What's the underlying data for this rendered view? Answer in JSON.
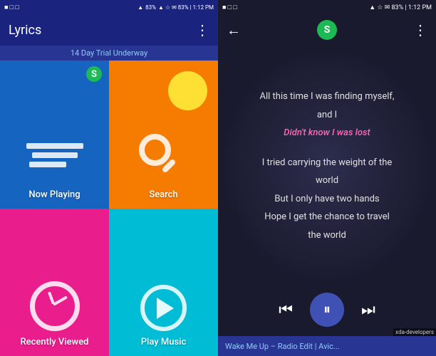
{
  "left": {
    "status_bar": {
      "left": "■ □ □",
      "right": "▲ ☆ ✉ 83% | 1:12 PM"
    },
    "title": "Lyrics",
    "menu_icon": "⋮",
    "trial_text": "14 Day Trial Underway",
    "spotify_label": "S",
    "cells": [
      {
        "id": "now-playing",
        "label": "Now Playing",
        "color": "#1565c0"
      },
      {
        "id": "search",
        "label": "Search",
        "color": "#f57c00"
      },
      {
        "id": "recently-viewed",
        "label": "Recently Viewed",
        "color": "#e91e8c"
      },
      {
        "id": "play-music",
        "label": "Play Music",
        "color": "#00bcd4"
      }
    ]
  },
  "right": {
    "status_bar": {
      "left": "■ □ □",
      "right": "▲ ☆ ✉ 83% | 1:12 PM"
    },
    "back_icon": "←",
    "spotify_label": "S",
    "menu_icon": "⋮",
    "lyrics": [
      {
        "text": "All this time I was finding myself,",
        "style": "normal"
      },
      {
        "text": "and I",
        "style": "normal"
      },
      {
        "text": "Didn't know I was lost",
        "style": "italic-pink"
      },
      {
        "text": "",
        "style": "spacer"
      },
      {
        "text": "I tried carrying the weight of the",
        "style": "normal"
      },
      {
        "text": "world",
        "style": "normal"
      },
      {
        "text": "But I only have two hands",
        "style": "normal"
      },
      {
        "text": "Hope I get the chance to travel",
        "style": "normal"
      },
      {
        "text": "the world",
        "style": "normal"
      }
    ],
    "controls": {
      "prev_icon": "⏮",
      "pause_icon": "⏸",
      "next_icon": "⏭"
    },
    "now_playing": "Wake Me Up – Radio Edit | Avic..."
  }
}
